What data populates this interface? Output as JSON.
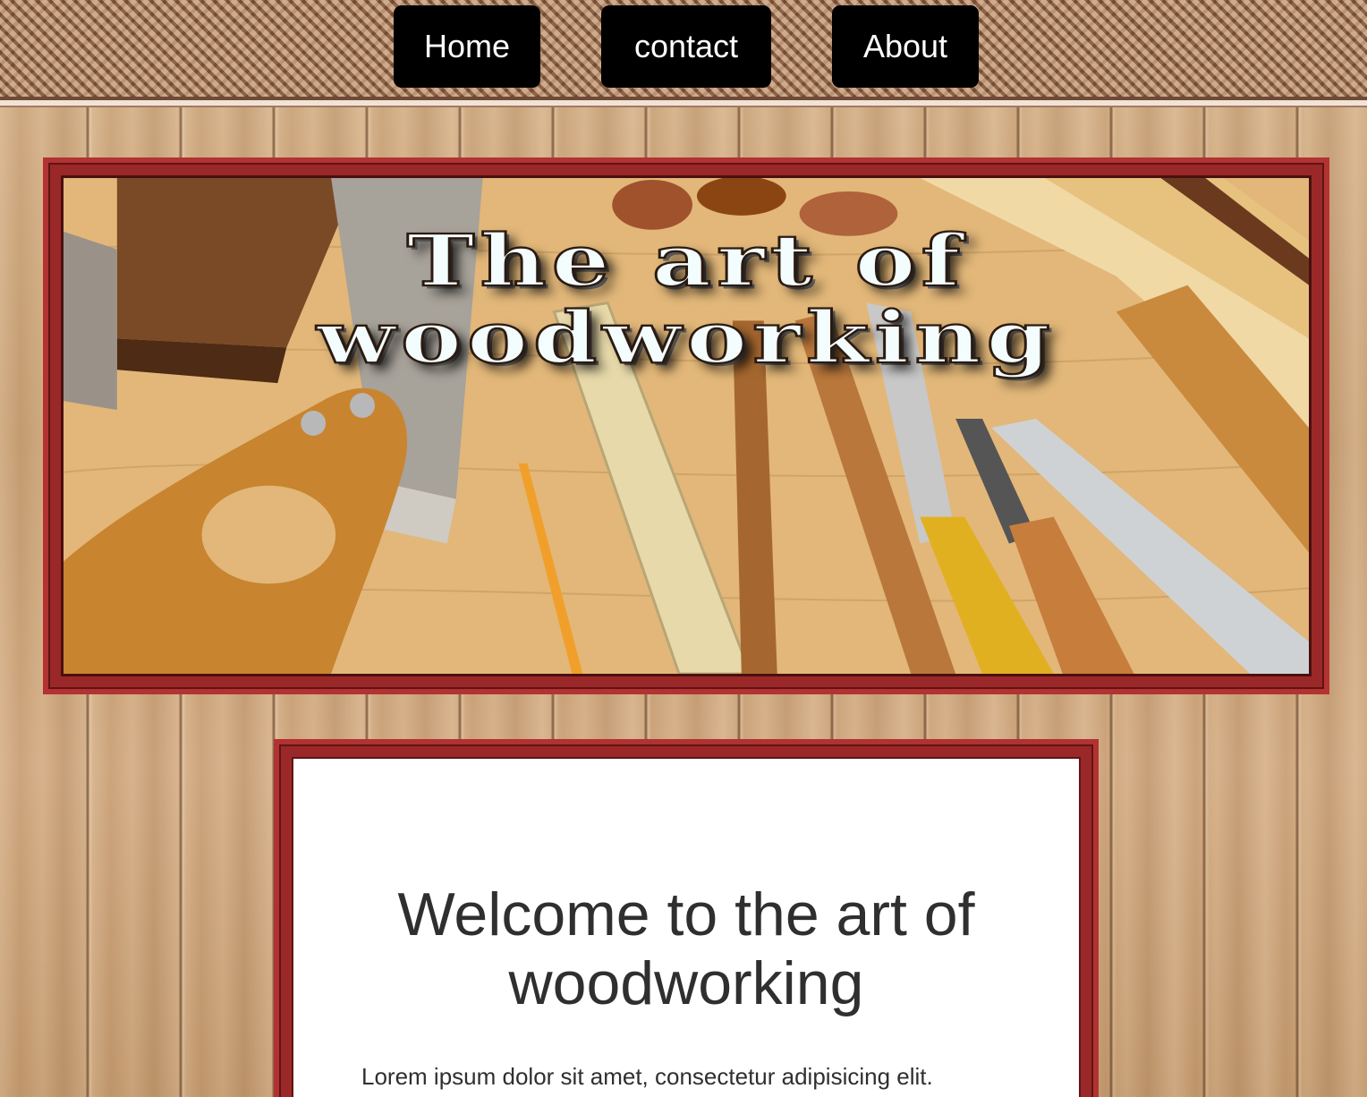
{
  "nav": {
    "items": [
      {
        "label": "Home"
      },
      {
        "label": "contact"
      },
      {
        "label": "About"
      }
    ]
  },
  "hero": {
    "title": "The art of woodworking",
    "image_alt_subject": "woodworking tools on a wooden bench"
  },
  "content": {
    "heading": "Welcome to the art of woodworking",
    "body": "Lorem ipsum dolor sit amet, consectetur adipisicing elit."
  },
  "colors": {
    "frame": "#9a2828",
    "nav_button": "#000000",
    "nav_text": "#ffffff",
    "heading_text": "#2f2f2f",
    "hero_title_fill": "#f3fdfd"
  }
}
